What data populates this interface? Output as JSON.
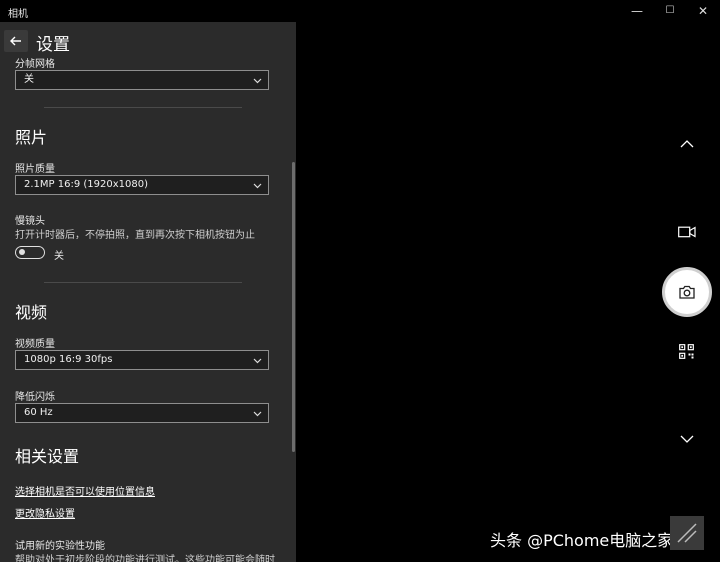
{
  "window": {
    "app_title": "相机",
    "min_glyph": "—",
    "max_glyph": "☐",
    "close_glyph": "✕"
  },
  "panel": {
    "title": "设置",
    "top_partial_label": "分帧网格",
    "framing_grid_value": "关",
    "photos": {
      "heading": "照片",
      "quality_label": "照片质量",
      "quality_value": "2.1MP 16:9 (1920x1080)",
      "timelapse_label": "慢镜头",
      "timelapse_desc": "打开计时器后，不停拍照，直到再次按下相机按钮为止",
      "timelapse_toggle_label": "关"
    },
    "videos": {
      "heading": "视频",
      "quality_label": "视频质量",
      "quality_value": "1080p 16:9 30fps",
      "flicker_label": "降低闪烁",
      "flicker_value": "60 Hz"
    },
    "related": {
      "heading": "相关设置",
      "link_location": "选择相机是否可以使用位置信息",
      "link_privacy": "更改隐私设置",
      "experimental_label": "试用新的实验性功能",
      "experimental_desc": "帮助对处于初步阶段的功能进行测试。这些功能可能会随时"
    }
  },
  "camera_controls": {
    "up_icon": "chevron-up-icon",
    "video_icon": "video-camera-icon",
    "shutter_icon": "camera-icon",
    "qr_icon": "qr-code-icon",
    "down_icon": "chevron-down-icon"
  },
  "watermark": {
    "text": "头条 @PChome电脑之家"
  }
}
